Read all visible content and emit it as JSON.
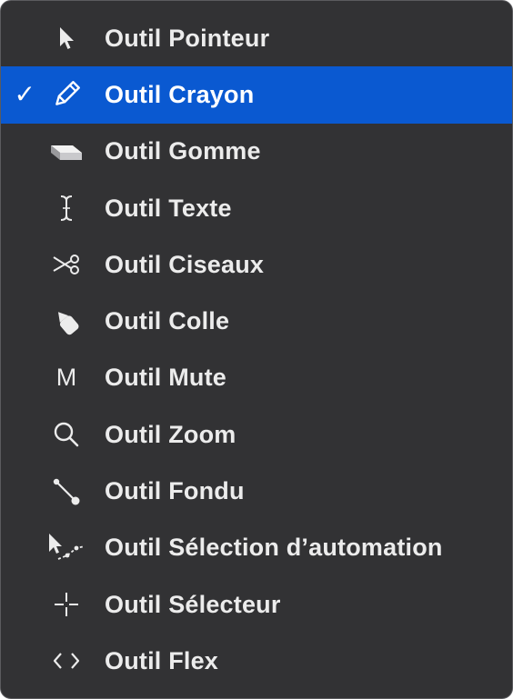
{
  "menu": {
    "items": [
      {
        "label": "Outil Pointeur",
        "icon": "pointer-arrow-icon",
        "checked": false
      },
      {
        "label": "Outil Crayon",
        "icon": "pencil-icon",
        "checked": true,
        "check_mark": "✓"
      },
      {
        "label": "Outil Gomme",
        "icon": "eraser-icon",
        "checked": false
      },
      {
        "label": "Outil Texte",
        "icon": "text-cursor-icon",
        "checked": false
      },
      {
        "label": "Outil Ciseaux",
        "icon": "scissors-icon",
        "checked": false
      },
      {
        "label": "Outil Colle",
        "icon": "glue-icon",
        "checked": false
      },
      {
        "label": "Outil Mute",
        "icon": "mute-m-icon",
        "icon_glyph": "M",
        "checked": false
      },
      {
        "label": "Outil Zoom",
        "icon": "magnifier-icon",
        "checked": false
      },
      {
        "label": "Outil Fondu",
        "icon": "fade-line-icon",
        "checked": false
      },
      {
        "label": "Outil Sélection d’automation",
        "icon": "automation-select-icon",
        "checked": false
      },
      {
        "label": "Outil Sélecteur",
        "icon": "crosshair-icon",
        "checked": false
      },
      {
        "label": "Outil Flex",
        "icon": "flex-brackets-icon",
        "checked": false
      }
    ]
  },
  "colors": {
    "menu_background": "#323234",
    "selected_background": "#0a59d1",
    "text": "#ececec"
  }
}
